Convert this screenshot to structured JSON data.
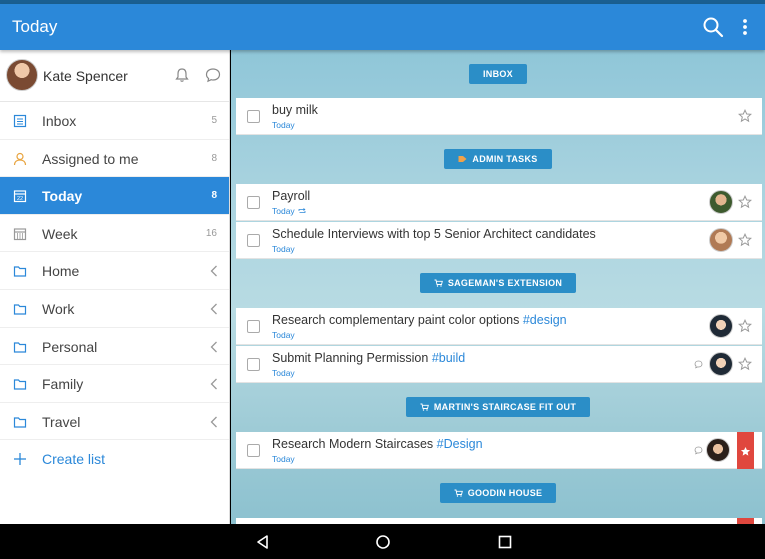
{
  "appbar": {
    "title": "Today",
    "search_icon": "search-icon",
    "more_icon": "more-vert-icon",
    "color": "#2b88d9"
  },
  "profile": {
    "name": "Kate Spencer"
  },
  "sidebar": {
    "items": [
      {
        "label": "Inbox",
        "count": "5",
        "icon": "inbox-icon"
      },
      {
        "label": "Assigned to me",
        "count": "8",
        "icon": "person-icon"
      },
      {
        "label": "Today",
        "count": "8",
        "icon": "calendar-today-icon",
        "active": true
      },
      {
        "label": "Week",
        "count": "16",
        "icon": "calendar-week-icon"
      },
      {
        "label": "Home",
        "icon": "folder-icon"
      },
      {
        "label": "Work",
        "icon": "folder-icon"
      },
      {
        "label": "Personal",
        "icon": "folder-icon"
      },
      {
        "label": "Family",
        "icon": "folder-icon"
      },
      {
        "label": "Travel",
        "icon": "folder-icon"
      }
    ],
    "create_label": "Create list"
  },
  "sections": [
    {
      "label": "INBOX"
    },
    {
      "label": "ADMIN TASKS"
    },
    {
      "label": "SAGEMAN'S EXTENSION"
    },
    {
      "label": "MARTIN'S STAIRCASE FIT OUT"
    },
    {
      "label": "GOODIN HOUSE"
    }
  ],
  "tasks": [
    {
      "title": "buy milk",
      "due": "Today"
    },
    {
      "title": "Payroll",
      "due": "Today"
    },
    {
      "title": "Schedule Interviews with top 5 Senior Architect candidates",
      "due": "Today"
    },
    {
      "title": "Research complementary paint color options",
      "tag": "#design",
      "due": "Today"
    },
    {
      "title": "Submit Planning Permission",
      "tag": "#build",
      "due": "Today"
    },
    {
      "title": "Research Modern Staircases",
      "tag": "#Design",
      "due": "Today"
    }
  ]
}
